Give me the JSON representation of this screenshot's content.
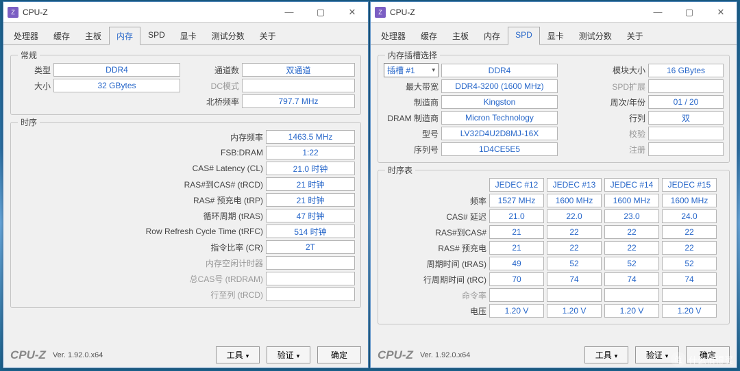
{
  "app": {
    "title": "CPU-Z",
    "brand": "CPU-Z",
    "version": "Ver. 1.92.0.x64"
  },
  "winbtns": {
    "min": "—",
    "max": "▢",
    "close": "✕"
  },
  "tabs": {
    "cpu": "处理器",
    "cache": "缓存",
    "mb": "主板",
    "mem": "内存",
    "spd": "SPD",
    "gpu": "显卡",
    "bench": "测试分数",
    "about": "关于"
  },
  "footer": {
    "tools": "工具",
    "validate": "验证",
    "ok": "确定"
  },
  "watermark": "什么值得买",
  "mem": {
    "group_general": "常规",
    "type_lbl": "类型",
    "type": "DDR4",
    "size_lbl": "大小",
    "size": "32 GBytes",
    "channels_lbl": "通道数",
    "channels": "双通道",
    "dcmode_lbl": "DC模式",
    "dcmode": "",
    "nbfreq_lbl": "北桥频率",
    "nbfreq": "797.7 MHz",
    "group_timings": "时序",
    "t": [
      {
        "lbl": "内存频率",
        "val": "1463.5 MHz",
        "gray": false
      },
      {
        "lbl": "FSB:DRAM",
        "val": "1:22",
        "gray": false
      },
      {
        "lbl": "CAS# Latency (CL)",
        "val": "21.0 时钟",
        "gray": false
      },
      {
        "lbl": "RAS#到CAS# (tRCD)",
        "val": "21 时钟",
        "gray": false
      },
      {
        "lbl": "RAS# 预充电 (tRP)",
        "val": "21 时钟",
        "gray": false
      },
      {
        "lbl": "循环周期 (tRAS)",
        "val": "47 时钟",
        "gray": false
      },
      {
        "lbl": "Row Refresh Cycle Time (tRFC)",
        "val": "514 时钟",
        "gray": false
      },
      {
        "lbl": "指令比率 (CR)",
        "val": "2T",
        "gray": false
      },
      {
        "lbl": "内存空闲计时器",
        "val": "",
        "gray": true
      },
      {
        "lbl": "总CAS号 (tRDRAM)",
        "val": "",
        "gray": true
      },
      {
        "lbl": "行至列 (tRCD)",
        "val": "",
        "gray": true
      }
    ]
  },
  "spd": {
    "group_slot": "内存插槽选择",
    "slot_lbl": "插槽 #1",
    "type": "DDR4",
    "modsize_lbl": "模块大小",
    "modsize": "16 GBytes",
    "maxbw_lbl": "最大带宽",
    "maxbw": "DDR4-3200 (1600 MHz)",
    "spdext_lbl": "SPD扩展",
    "spdext": "",
    "manuf_lbl": "制造商",
    "manuf": "Kingston",
    "week_lbl": "周次/年份",
    "week": "01 / 20",
    "dram_lbl": "DRAM 制造商",
    "dram": "Micron Technology",
    "ranks_lbl": "行列",
    "ranks": "双",
    "part_lbl": "型号",
    "part": "LV32D4U2D8MJ-16X",
    "correction_lbl": "校验",
    "correction": "",
    "serial_lbl": "序列号",
    "serial": "1D4CE5E5",
    "reg_lbl": "注册",
    "reg": "",
    "group_table": "时序表",
    "cols": [
      "JEDEC #12",
      "JEDEC #13",
      "JEDEC #14",
      "JEDEC #15"
    ],
    "rows": [
      {
        "lbl": "频率",
        "v": [
          "1527 MHz",
          "1600 MHz",
          "1600 MHz",
          "1600 MHz"
        ],
        "gray": false
      },
      {
        "lbl": "CAS# 延迟",
        "v": [
          "21.0",
          "22.0",
          "23.0",
          "24.0"
        ],
        "gray": false
      },
      {
        "lbl": "RAS#到CAS#",
        "v": [
          "21",
          "22",
          "22",
          "22"
        ],
        "gray": false
      },
      {
        "lbl": "RAS# 预充电",
        "v": [
          "21",
          "22",
          "22",
          "22"
        ],
        "gray": false
      },
      {
        "lbl": "周期时间 (tRAS)",
        "v": [
          "49",
          "52",
          "52",
          "52"
        ],
        "gray": false
      },
      {
        "lbl": "行周期时间 (tRC)",
        "v": [
          "70",
          "74",
          "74",
          "74"
        ],
        "gray": false
      },
      {
        "lbl": "命令率",
        "v": [
          "",
          "",
          "",
          ""
        ],
        "gray": true
      },
      {
        "lbl": "电压",
        "v": [
          "1.20 V",
          "1.20 V",
          "1.20 V",
          "1.20 V"
        ],
        "gray": false
      }
    ]
  }
}
